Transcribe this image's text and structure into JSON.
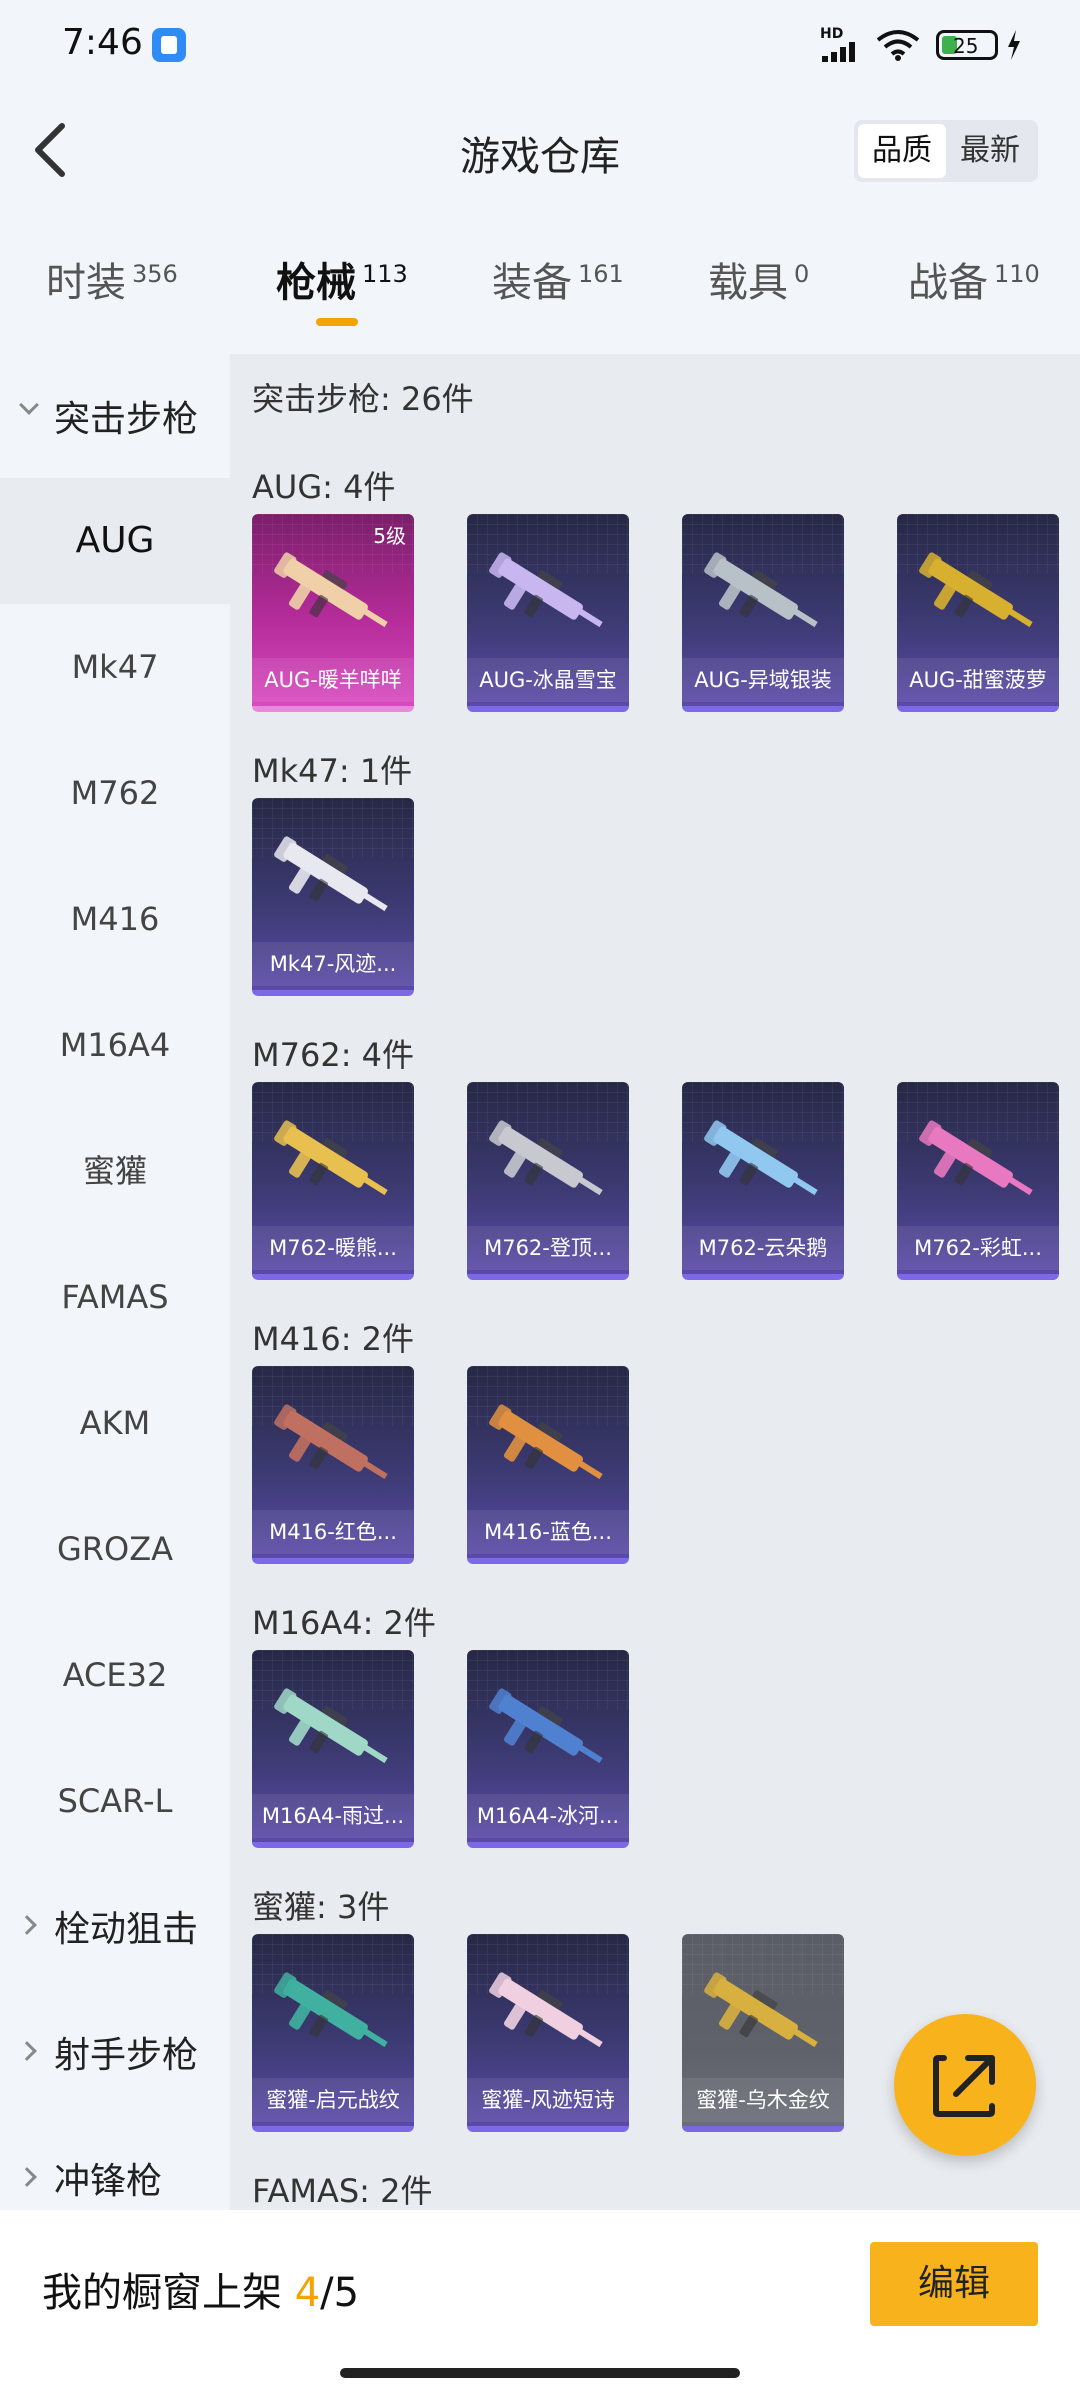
{
  "status": {
    "time": "7:46",
    "network": "HD",
    "battery": "25"
  },
  "header": {
    "title": "游戏仓库",
    "sort_options": [
      "品质",
      "最新"
    ],
    "sort_active": "品质"
  },
  "tabs": [
    {
      "label": "时装",
      "count": "356"
    },
    {
      "label": "枪械",
      "count": "113"
    },
    {
      "label": "装备",
      "count": "161"
    },
    {
      "label": "载具",
      "count": "0"
    },
    {
      "label": "战备",
      "count": "110"
    }
  ],
  "sidebar": {
    "group_open": "突击步枪",
    "items": [
      "AUG",
      "Mk47",
      "M762",
      "M416",
      "M16A4",
      "蜜獾",
      "FAMAS",
      "AKM",
      "GROZA",
      "ACE32",
      "SCAR-L"
    ],
    "groups_closed": [
      "栓动狙击",
      "射手步枪",
      "冲锋枪"
    ]
  },
  "content": {
    "category_header": "突击步枪: 26件",
    "groups": [
      {
        "label": "AUG: 4件",
        "cards": [
          {
            "name": "AUG-暖羊咩咩",
            "style": "pink",
            "level": "5级",
            "color": "#f0d0a8"
          },
          {
            "name": "AUG-冰晶雪宝",
            "style": "purple",
            "color": "#c8b6f0"
          },
          {
            "name": "AUG-异域银装",
            "style": "purple",
            "color": "#b8c0c8"
          },
          {
            "name": "AUG-甜蜜菠萝",
            "style": "purple",
            "color": "#d8b030"
          }
        ]
      },
      {
        "label": "Mk47: 1件",
        "cards": [
          {
            "name": "Mk47-风迹...",
            "style": "purple",
            "color": "#e8e8f0"
          }
        ]
      },
      {
        "label": "M762: 4件",
        "cards": [
          {
            "name": "M762-暖熊...",
            "style": "purple",
            "color": "#e8c050"
          },
          {
            "name": "M762-登顶...",
            "style": "purple",
            "color": "#c8c8d0"
          },
          {
            "name": "M762-云朵鹅",
            "style": "purple",
            "color": "#90c8f0"
          },
          {
            "name": "M762-彩虹...",
            "style": "purple",
            "color": "#e878c0"
          }
        ]
      },
      {
        "label": "M416: 2件",
        "cards": [
          {
            "name": "M416-红色...",
            "style": "purple",
            "color": "#c07060"
          },
          {
            "name": "M416-蓝色...",
            "style": "purple",
            "color": "#e09040"
          }
        ]
      },
      {
        "label": "M16A4: 2件",
        "cards": [
          {
            "name": "M16A4-雨过...",
            "style": "purple",
            "color": "#a0d8c8"
          },
          {
            "name": "M16A4-冰河...",
            "style": "purple",
            "color": "#5080d0"
          }
        ]
      },
      {
        "label": "蜜獾: 3件",
        "cards": [
          {
            "name": "蜜獾-启元战纹",
            "style": "purple",
            "color": "#40b0a0"
          },
          {
            "name": "蜜獾-风迹短诗",
            "style": "purple",
            "color": "#f0d0e0"
          },
          {
            "name": "蜜獾-乌木金纹",
            "style": "grey",
            "color": "#d8b040"
          }
        ]
      },
      {
        "label": "FAMAS: 2件",
        "cards": []
      }
    ]
  },
  "bottom": {
    "shelf_prefix": "我的橱窗上架 ",
    "shelf_current": "4",
    "shelf_total": "/5",
    "edit_label": "编辑"
  }
}
